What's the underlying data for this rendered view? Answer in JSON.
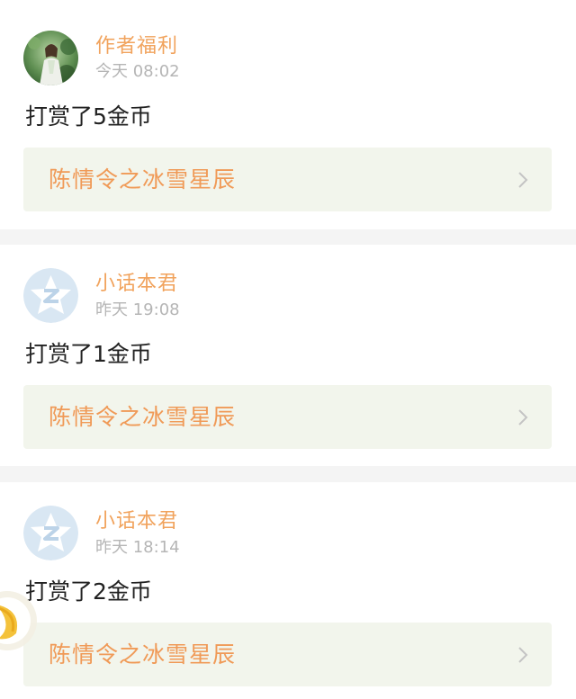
{
  "feed": {
    "items": [
      {
        "user_name": "作者福利",
        "time": "今天 08:02",
        "reward_text": "打赏了5金币",
        "book_title": "陈情令之冰雪星辰",
        "avatar_icon": "photo-avatar"
      },
      {
        "user_name": "小话本君",
        "time": "昨天 19:08",
        "reward_text": "打赏了1金币",
        "book_title": "陈情令之冰雪星辰",
        "avatar_icon": "default-star-avatar"
      },
      {
        "user_name": "小话本君",
        "time": "昨天 18:14",
        "reward_text": "打赏了2金币",
        "book_title": "陈情令之冰雪星辰",
        "avatar_icon": "default-star-avatar"
      }
    ]
  },
  "colors": {
    "name": "#f1a35d",
    "book_title": "#f09a57",
    "book_link_bg": "#f2f5ec",
    "time": "#b5b5b5",
    "divider": "#f4f4f4"
  }
}
